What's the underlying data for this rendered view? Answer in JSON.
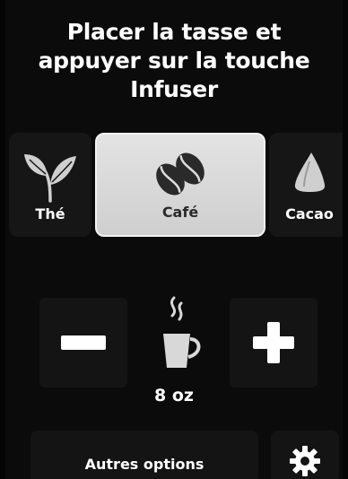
{
  "instruction": {
    "line1": "Placer la tasse et",
    "line2": "appuyer sur la touche Infuser"
  },
  "beverages": [
    {
      "label": "Thé",
      "icon": "tea-leaves-icon",
      "selected": false
    },
    {
      "label": "Café",
      "icon": "coffee-beans-icon",
      "selected": true
    },
    {
      "label": "Cacao",
      "icon": "cocoa-drop-icon",
      "selected": false
    }
  ],
  "size": {
    "value": "8 oz",
    "decrease_icon": "minus-icon",
    "increase_icon": "plus-icon"
  },
  "footer": {
    "options_label": "Autres options",
    "settings_icon": "gear-icon"
  },
  "colors": {
    "background": "#0b0b0b",
    "tile": "#161616",
    "selected_tile": "#dcdcdc",
    "text": "#ffffff",
    "selected_text": "#2a2a2a"
  }
}
